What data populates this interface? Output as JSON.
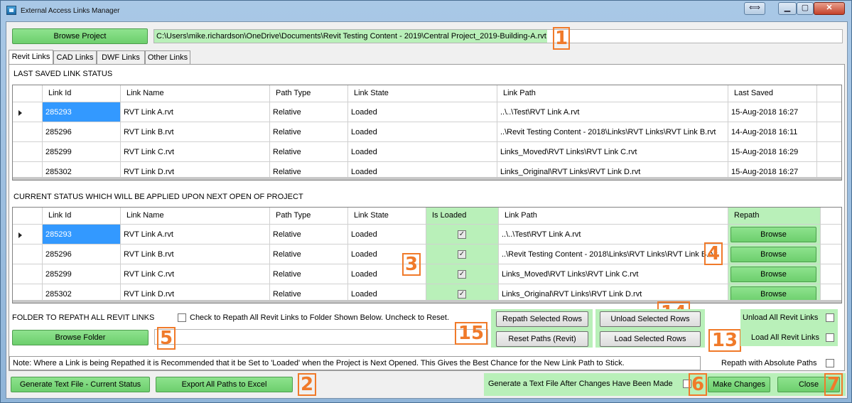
{
  "window": {
    "title": "External Access Links Manager"
  },
  "titlebar": {
    "resize_glyph": "⟺",
    "min_glyph": "▁",
    "max_glyph": "▢",
    "close_glyph": "✕"
  },
  "top": {
    "browse_project_label": "Browse Project",
    "project_path": "C:\\Users\\mike.richardson\\OneDrive\\Documents\\Revit Testing Content - 2019\\Central Project_2019-Building-A.rvt"
  },
  "tabs": [
    "Revit Links",
    "CAD Links",
    "DWF Links",
    "Other Links"
  ],
  "last_saved": {
    "title": "LAST SAVED LINK STATUS",
    "columns": [
      "Link Id",
      "Link Name",
      "Path Type",
      "Link State",
      "Link Path",
      "Last Saved"
    ],
    "rows": [
      [
        "285293",
        "RVT Link A.rvt",
        "Relative",
        "Loaded",
        "..\\..\\Test\\RVT Link A.rvt",
        "15-Aug-2018 16:27"
      ],
      [
        "285296",
        "RVT Link B.rvt",
        "Relative",
        "Loaded",
        "..\\Revit Testing Content - 2018\\Links\\RVT Links\\RVT Link B.rvt",
        "14-Aug-2018 16:11"
      ],
      [
        "285299",
        "RVT Link C.rvt",
        "Relative",
        "Loaded",
        "Links_Moved\\RVT Links\\RVT Link C.rvt",
        "15-Aug-2018 16:29"
      ],
      [
        "285302",
        "RVT Link D.rvt",
        "Relative",
        "Loaded",
        "Links_Original\\RVT Links\\RVT Link D.rvt",
        "15-Aug-2018 16:27"
      ]
    ]
  },
  "current": {
    "title": "CURRENT STATUS WHICH WILL BE APPLIED UPON NEXT OPEN OF PROJECT",
    "columns": [
      "Link Id",
      "Link Name",
      "Path Type",
      "Link State",
      "Is Loaded",
      "Link Path",
      "Repath"
    ],
    "rows": [
      [
        "285293",
        "RVT Link A.rvt",
        "Relative",
        "Loaded",
        "..\\..\\Test\\RVT Link A.rvt"
      ],
      [
        "285296",
        "RVT Link B.rvt",
        "Relative",
        "Loaded",
        "..\\Revit Testing Content - 2018\\Links\\RVT Links\\RVT Link B.rvt"
      ],
      [
        "285299",
        "RVT Link C.rvt",
        "Relative",
        "Loaded",
        "Links_Moved\\RVT Links\\RVT Link C.rvt"
      ],
      [
        "285302",
        "RVT Link D.rvt",
        "Relative",
        "Loaded",
        "Links_Original\\RVT Links\\RVT Link D.rvt"
      ]
    ],
    "is_loaded": [
      true,
      true,
      true,
      true
    ],
    "browse_label": "Browse",
    "check_glyph": "✓"
  },
  "folder": {
    "title": "FOLDER TO REPATH ALL REVIT LINKS",
    "check_label": "Check to Repath All Revit Links to Folder Shown Below. Uncheck to Reset.",
    "browse_folder_label": "Browse Folder",
    "folder_value": ""
  },
  "actions": {
    "repath_selected": "Repath Selected Rows",
    "reset_paths": "Reset Paths (Revit)",
    "unload_selected": "Unload Selected Rows",
    "load_selected": "Load Selected Rows",
    "unload_all": "Unload All Revit Links",
    "load_all": "Load All Revit Links"
  },
  "note": "Note: Where a Link is being Repathed it is Recommended that it be Set to 'Loaded' when the Project is Next Opened. This Gives the Best Chance for the New Link Path to Stick.",
  "bottom": {
    "repath_absolute": "Repath with Absolute Paths",
    "generate_text": "Generate Text File - Current Status",
    "export_excel": "Export All Paths to Excel",
    "generate_after": "Generate a Text File After Changes Have Been Made",
    "make_changes": "Make Changes",
    "close": "Close"
  },
  "annotations": [
    "1",
    "2",
    "3",
    "4",
    "5",
    "6",
    "7",
    "13",
    "14",
    "15"
  ],
  "colors": {
    "highlight_green": "#b9f0b9",
    "button_green": "#7ed67e",
    "selection_blue": "#3399ff",
    "annotation_orange": "#f07a2a"
  }
}
